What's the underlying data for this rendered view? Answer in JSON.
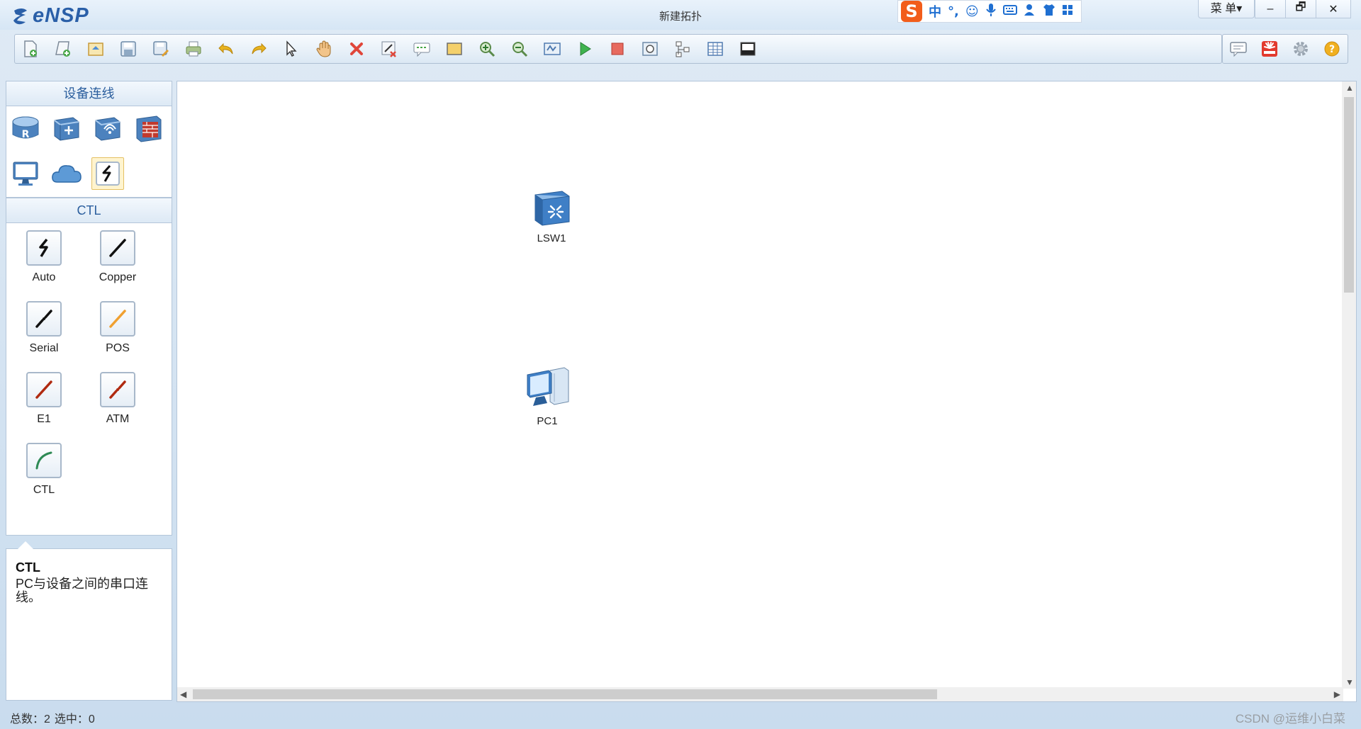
{
  "app": {
    "logo": "eNSP",
    "window_title": "新建拓扑"
  },
  "ime": {
    "logo": "S",
    "mode": "中",
    "punct": "°,"
  },
  "window_controls": {
    "menu": "菜 单▾",
    "minimize": "–",
    "restore": "🗗",
    "close": "✕"
  },
  "toolbar": {
    "icons": [
      "new-topology-icon",
      "new-test-icon",
      "open-icon",
      "save-icon",
      "save-as-icon",
      "print-icon",
      "undo-icon",
      "redo-icon",
      "select-icon",
      "pan-hand-icon",
      "delete-icon",
      "delete-link-icon",
      "text-annotation-icon",
      "area-icon",
      "zoom-in-icon",
      "zoom-out-icon",
      "topology-fit-icon",
      "start-device-icon",
      "stop-device-icon",
      "capture-icon",
      "topology-layout-icon",
      "table-icon",
      "screenshot-icon"
    ],
    "right_icons": [
      "chat-icon",
      "huawei-icon",
      "settings-icon",
      "help-icon"
    ]
  },
  "left_panel": {
    "device_header": "设备连线",
    "devices": [
      "router-icon",
      "switch-icon",
      "wlan-icon",
      "firewall-icon",
      "pc-icon",
      "cloud-icon",
      "connection-icon"
    ],
    "selected_category": "CTL",
    "cables": [
      {
        "label": "Auto",
        "color": "#111111"
      },
      {
        "label": "Copper",
        "color": "#111111"
      },
      {
        "label": "Serial",
        "color": "#111111"
      },
      {
        "label": "POS",
        "color": "#f0a030"
      },
      {
        "label": "E1",
        "color": "#b02a10"
      },
      {
        "label": "ATM",
        "color": "#b02a10"
      },
      {
        "label": "CTL",
        "color": "#2f8a55"
      }
    ],
    "description": {
      "title": "CTL",
      "text": "PC与设备之间的串口连线。"
    }
  },
  "canvas": {
    "nodes": [
      {
        "label": "LSW1",
        "type": "switch"
      },
      {
        "label": "PC1",
        "type": "pc"
      }
    ]
  },
  "status": {
    "total": "总数：2",
    "selected": "选中：0"
  },
  "watermark": "CSDN @运维小白菜"
}
